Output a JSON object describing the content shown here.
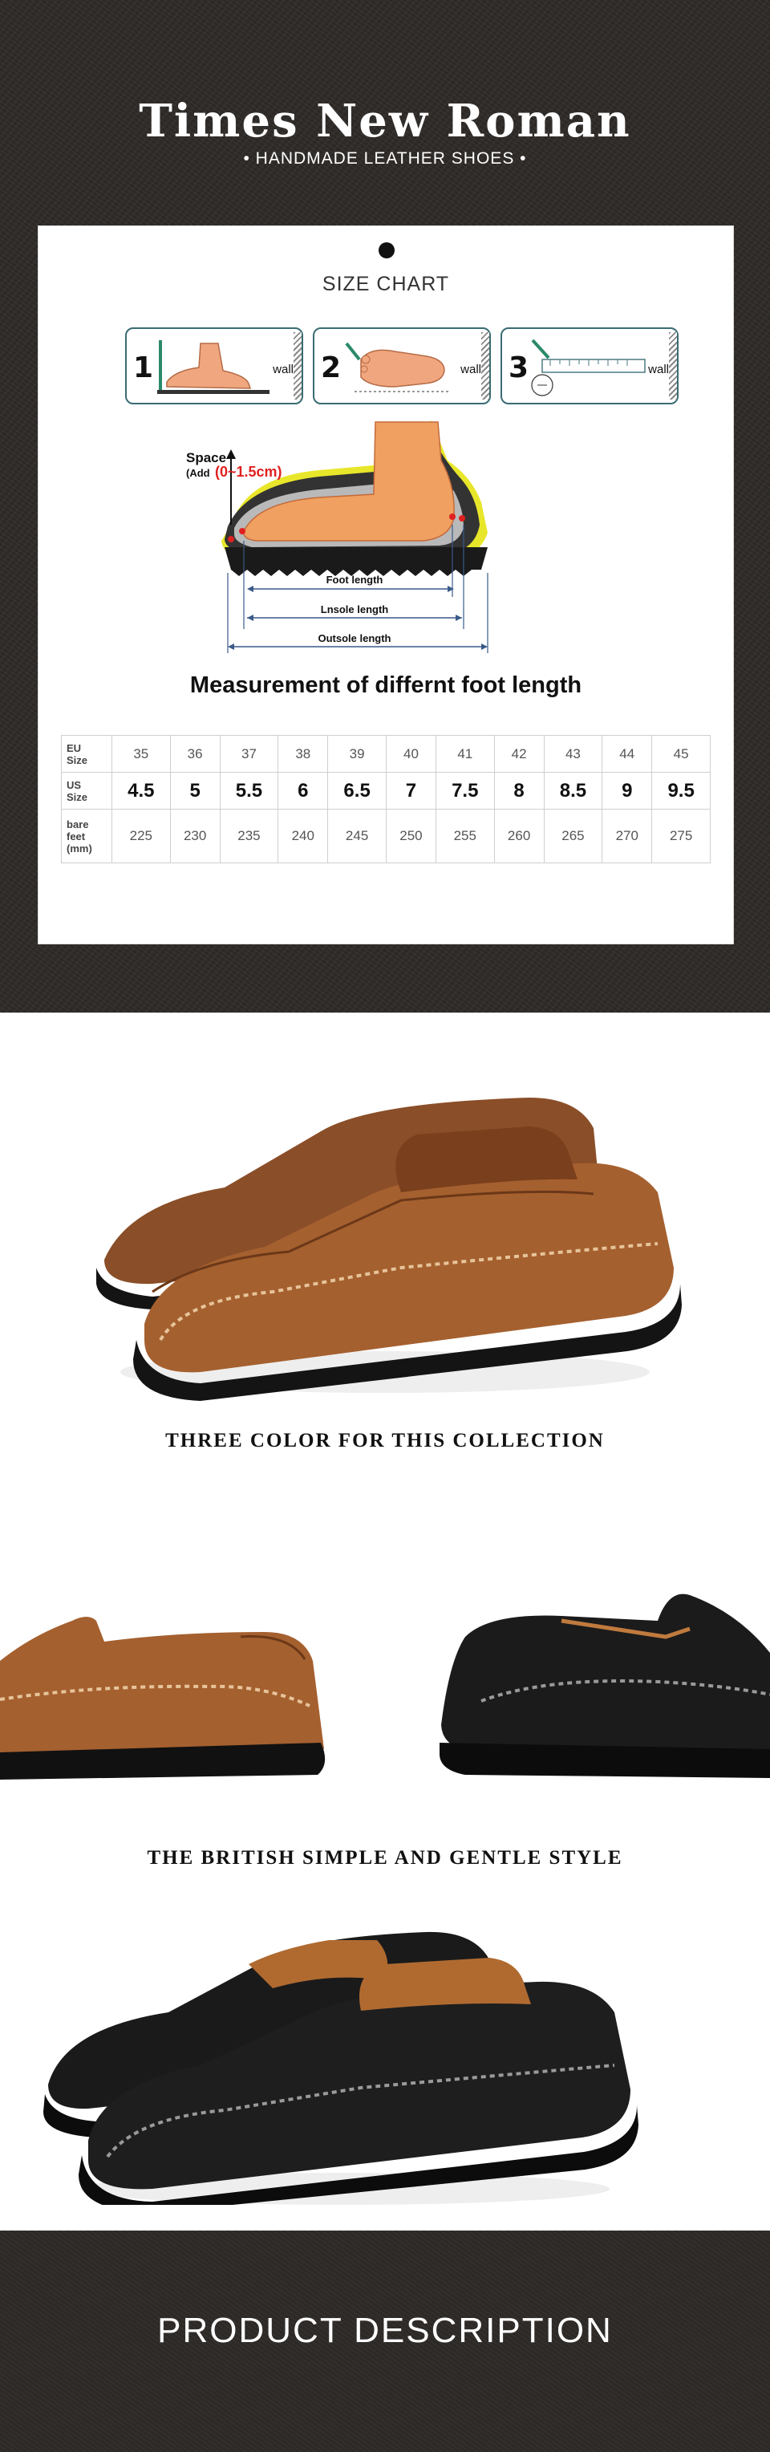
{
  "header": {
    "brand": "Times New Roman",
    "subtitle": "• HANDMADE LEATHER SHOES •"
  },
  "size_chart": {
    "title": "SIZE CHART",
    "steps": [
      {
        "num": "1",
        "label": "wall"
      },
      {
        "num": "2",
        "label": "wall"
      },
      {
        "num": "3",
        "label": "wall"
      }
    ],
    "diagram": {
      "space_label": "Space",
      "space_add": "(Add",
      "space_range": "(0~1.5cm)",
      "foot_length": "Foot length",
      "insole_length": "Lnsole length",
      "outsole_length": "Outsole length"
    },
    "heading": "Measurement of differnt foot length",
    "table": {
      "eu_label": [
        "EU",
        "Size"
      ],
      "us_label": [
        "US",
        "Size"
      ],
      "mm_label": [
        "bare",
        "feet",
        "(mm)"
      ],
      "eu": [
        "35",
        "36",
        "37",
        "38",
        "39",
        "40",
        "41",
        "42",
        "43",
        "44",
        "45"
      ],
      "us": [
        "4.5",
        "5",
        "5.5",
        "6",
        "6.5",
        "7",
        "7.5",
        "8",
        "8.5",
        "9",
        "9.5"
      ],
      "mm": [
        "225",
        "230",
        "235",
        "240",
        "245",
        "250",
        "255",
        "260",
        "265",
        "270",
        "275"
      ]
    }
  },
  "captions": {
    "colors": "THREE COLOR FOR THIS COLLECTION",
    "style": "THE BRITISH SIMPLE AND GENTLE STYLE"
  },
  "footer": {
    "title": "PRODUCT DESCRIPTION"
  },
  "colors": {
    "brown_leather": "#9a5a2e",
    "black_leather": "#161616",
    "dark_bg": "#2e2a27"
  }
}
